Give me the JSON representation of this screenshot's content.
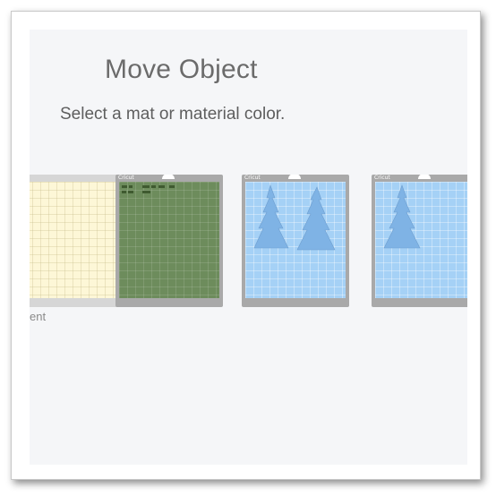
{
  "dialog": {
    "title": "Move Object",
    "subtitle": "Select a mat or material color."
  },
  "mats": [
    {
      "id": "mat-1",
      "color": "#fdf7d7",
      "caption": "ent",
      "selected": true
    },
    {
      "id": "mat-2",
      "color": "#6d8c5c",
      "brand": "Cricut",
      "content": "small-text-items"
    },
    {
      "id": "mat-3",
      "color": "#a5d1f6",
      "brand": "Cricut",
      "content": "two-trees"
    },
    {
      "id": "mat-4",
      "color": "#a5d1f6",
      "brand": "Cricut",
      "content": "one-tree"
    }
  ]
}
